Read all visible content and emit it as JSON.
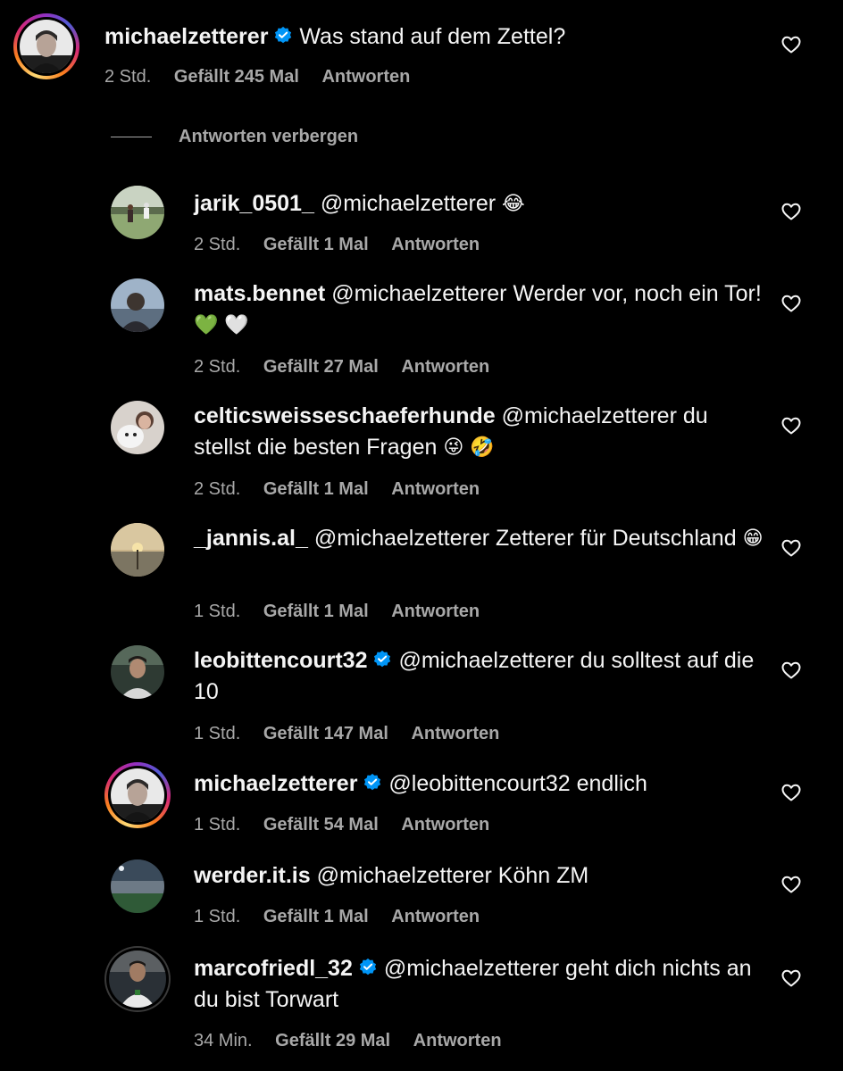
{
  "comments": [
    {
      "username": "michaelzetterer",
      "verified": true,
      "text": "Was stand auf dem Zettel?",
      "time": "2 Std.",
      "likes": "Gefällt 245 Mal",
      "reply": "Antworten"
    }
  ],
  "hide_replies_label": "Antworten verbergen",
  "replies": [
    {
      "username": "jarik_0501_",
      "verified": false,
      "text": "@michaelzetterer",
      "emoji": "😂",
      "time": "2 Std.",
      "likes": "Gefällt 1 Mal",
      "reply": "Antworten"
    },
    {
      "username": "mats.bennet",
      "verified": false,
      "text": "@michaelzetterer Werder vor, noch ein Tor!",
      "emoji": "💚 🤍",
      "time": "2 Std.",
      "likes": "Gefällt 27 Mal",
      "reply": "Antworten"
    },
    {
      "username": "celticsweisseschaeferhunde",
      "verified": false,
      "text": "@michaelzetterer du stellst die besten Fragen",
      "emoji": "😜 🤣",
      "time": "2 Std.",
      "likes": "Gefällt 1 Mal",
      "reply": "Antworten"
    },
    {
      "username": "_jannis.al_",
      "verified": false,
      "text": "@michaelzetterer Zetterer für Deutschland",
      "emoji": "😁",
      "time": "1 Std.",
      "likes": "Gefällt 1 Mal",
      "reply": "Antworten"
    },
    {
      "username": "leobittencourt32",
      "verified": true,
      "text": "@michaelzetterer du solltest auf die 10",
      "emoji": "",
      "time": "1 Std.",
      "likes": "Gefällt 147 Mal",
      "reply": "Antworten"
    },
    {
      "username": "michaelzetterer",
      "verified": true,
      "text": "@leobittencourt32 endlich",
      "emoji": "",
      "time": "1 Std.",
      "likes": "Gefällt 54 Mal",
      "reply": "Antworten"
    },
    {
      "username": "werder.it.is",
      "verified": false,
      "text": "@michaelzetterer Köhn ZM",
      "emoji": "",
      "time": "1 Std.",
      "likes": "Gefällt 1 Mal",
      "reply": "Antworten"
    },
    {
      "username": "marcofriedl_32",
      "verified": true,
      "text": "@michaelzetterer geht dich nichts an du bist Torwart",
      "emoji": "",
      "time": "34 Min.",
      "likes": "Gefällt 29 Mal",
      "reply": "Antworten"
    }
  ],
  "colors": {
    "background": "#000000",
    "text": "#f5f5f5",
    "secondary": "#a8a8a8",
    "verified": "#0095f6"
  }
}
